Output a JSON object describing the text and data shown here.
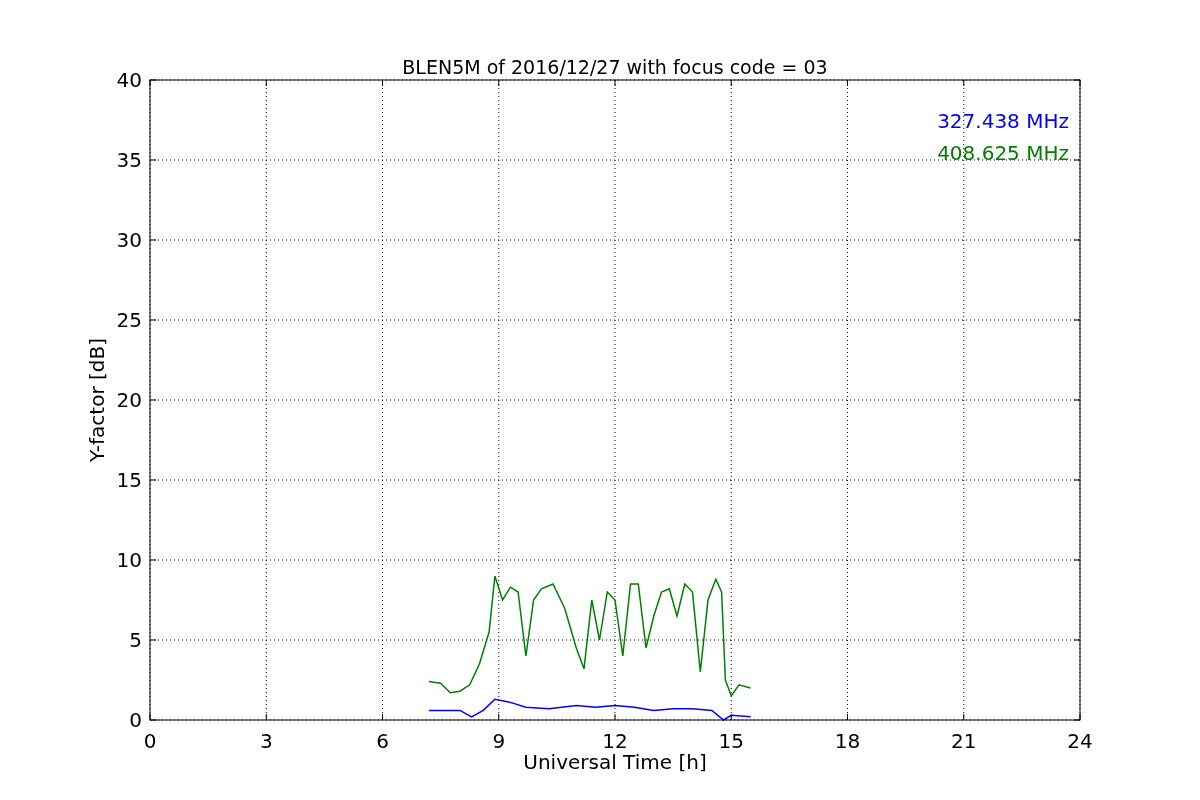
{
  "chart_data": {
    "type": "line",
    "title": "BLEN5M of 2016/12/27 with focus code = 03",
    "xlabel": "Universal Time [h]",
    "ylabel": "Y-factor [dB]",
    "grid": true,
    "xlim": [
      0,
      24
    ],
    "ylim": [
      0,
      40
    ],
    "xticks": [
      0,
      3,
      6,
      9,
      12,
      15,
      18,
      21,
      24
    ],
    "yticks": [
      0,
      5,
      10,
      15,
      20,
      25,
      30,
      35,
      40
    ],
    "series": [
      {
        "name": "327.438 MHz",
        "color": "#0000ff",
        "x": [
          7.2,
          8.0,
          8.3,
          8.6,
          8.9,
          9.3,
          9.7,
          10.3,
          11.0,
          11.5,
          12.0,
          12.5,
          13.0,
          13.5,
          14.0,
          14.5,
          14.8,
          15.0,
          15.5
        ],
        "values": [
          0.6,
          0.6,
          0.2,
          0.6,
          1.3,
          1.1,
          0.8,
          0.7,
          0.9,
          0.8,
          0.9,
          0.8,
          0.6,
          0.7,
          0.7,
          0.6,
          0.0,
          0.3,
          0.2
        ]
      },
      {
        "name": "408.625 MHz",
        "color": "#008000",
        "x": [
          7.2,
          7.5,
          7.75,
          8.0,
          8.25,
          8.5,
          8.75,
          8.9,
          9.1,
          9.3,
          9.5,
          9.7,
          9.9,
          10.1,
          10.4,
          10.7,
          11.0,
          11.2,
          11.4,
          11.6,
          11.8,
          12.0,
          12.2,
          12.4,
          12.6,
          12.8,
          13.0,
          13.2,
          13.4,
          13.6,
          13.8,
          14.0,
          14.2,
          14.4,
          14.6,
          14.75,
          14.85,
          15.0,
          15.2,
          15.5
        ],
        "values": [
          2.4,
          2.3,
          1.7,
          1.8,
          2.2,
          3.5,
          5.5,
          9.0,
          7.5,
          8.3,
          8.0,
          4.0,
          7.5,
          8.2,
          8.5,
          7.0,
          4.5,
          3.2,
          7.5,
          5.0,
          8.0,
          7.5,
          4.0,
          8.5,
          8.5,
          4.5,
          6.5,
          8.0,
          8.2,
          6.5,
          8.5,
          8.0,
          3.0,
          7.5,
          8.8,
          8.0,
          2.5,
          1.5,
          2.2,
          2.0
        ]
      }
    ]
  }
}
